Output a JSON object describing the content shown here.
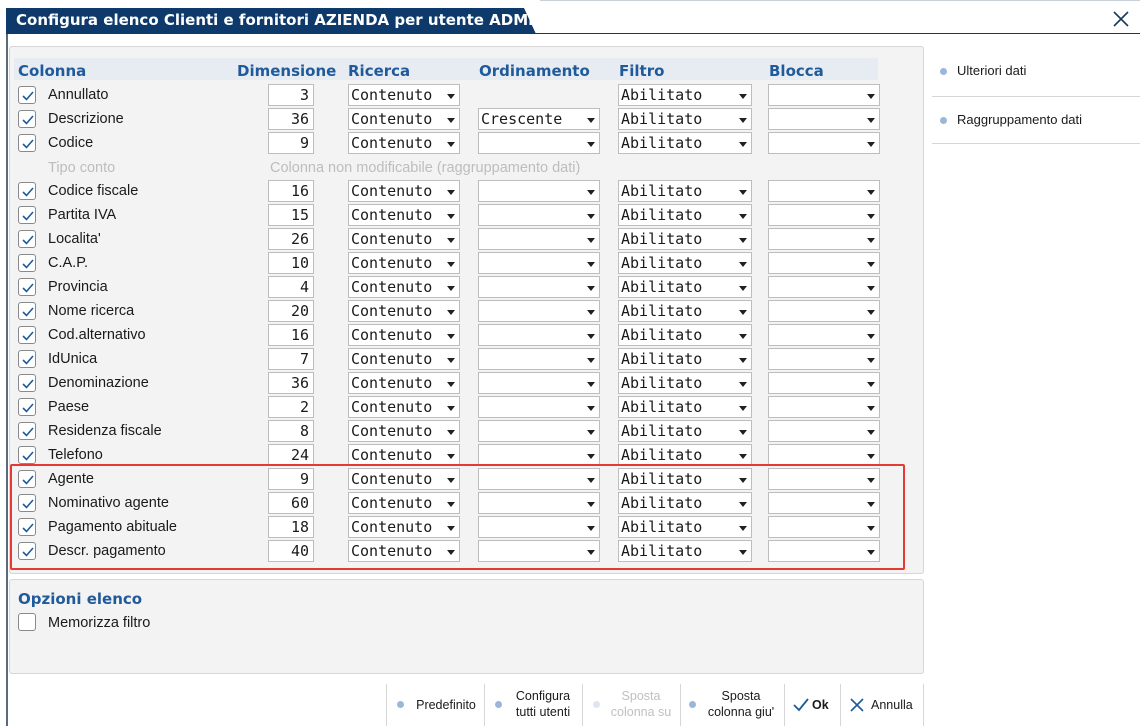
{
  "window": {
    "title": "Configura elenco Clienti e fornitori AZIENDA per utente ADMIN"
  },
  "headers": {
    "colonna": "Colonna",
    "dimensione": "Dimensione",
    "ricerca": "Ricerca",
    "ordinamento": "Ordinamento",
    "filtro": "Filtro",
    "blocca": "Blocca"
  },
  "rows": [
    {
      "name": "Annullato",
      "size": "3",
      "ricerca": "Contenuto",
      "ordinamento": null,
      "filtro": "Abilitato",
      "blocca": ""
    },
    {
      "name": "Descrizione",
      "size": "36",
      "ricerca": "Contenuto",
      "ordinamento": "Crescente",
      "filtro": "Abilitato",
      "blocca": ""
    },
    {
      "name": "Codice",
      "size": "9",
      "ricerca": "Contenuto",
      "ordinamento": "",
      "filtro": "Abilitato",
      "blocca": ""
    },
    {
      "name": "Codice fiscale",
      "size": "16",
      "ricerca": "Contenuto",
      "ordinamento": "",
      "filtro": "Abilitato",
      "blocca": ""
    },
    {
      "name": "Partita IVA",
      "size": "15",
      "ricerca": "Contenuto",
      "ordinamento": "",
      "filtro": "Abilitato",
      "blocca": ""
    },
    {
      "name": "Localita'",
      "size": "26",
      "ricerca": "Contenuto",
      "ordinamento": "",
      "filtro": "Abilitato",
      "blocca": ""
    },
    {
      "name": "C.A.P.",
      "size": "10",
      "ricerca": "Contenuto",
      "ordinamento": "",
      "filtro": "Abilitato",
      "blocca": ""
    },
    {
      "name": "Provincia",
      "size": "4",
      "ricerca": "Contenuto",
      "ordinamento": "",
      "filtro": "Abilitato",
      "blocca": ""
    },
    {
      "name": "Nome ricerca",
      "size": "20",
      "ricerca": "Contenuto",
      "ordinamento": "",
      "filtro": "Abilitato",
      "blocca": ""
    },
    {
      "name": "Cod.alternativo",
      "size": "16",
      "ricerca": "Contenuto",
      "ordinamento": "",
      "filtro": "Abilitato",
      "blocca": ""
    },
    {
      "name": "IdUnica",
      "size": "7",
      "ricerca": "Contenuto",
      "ordinamento": "",
      "filtro": "Abilitato",
      "blocca": ""
    },
    {
      "name": "Denominazione",
      "size": "36",
      "ricerca": "Contenuto",
      "ordinamento": "",
      "filtro": "Abilitato",
      "blocca": ""
    },
    {
      "name": "Paese",
      "size": "2",
      "ricerca": "Contenuto",
      "ordinamento": "",
      "filtro": "Abilitato",
      "blocca": ""
    },
    {
      "name": "Residenza fiscale",
      "size": "8",
      "ricerca": "Contenuto",
      "ordinamento": "",
      "filtro": "Abilitato",
      "blocca": ""
    },
    {
      "name": "Telefono",
      "size": "24",
      "ricerca": "Contenuto",
      "ordinamento": "",
      "filtro": "Abilitato",
      "blocca": ""
    },
    {
      "name": "Agente",
      "size": "9",
      "ricerca": "Contenuto",
      "ordinamento": "",
      "filtro": "Abilitato",
      "blocca": ""
    },
    {
      "name": "Nominativo agente",
      "size": "60",
      "ricerca": "Contenuto",
      "ordinamento": "",
      "filtro": "Abilitato",
      "blocca": ""
    },
    {
      "name": "Pagamento abituale",
      "size": "18",
      "ricerca": "Contenuto",
      "ordinamento": "",
      "filtro": "Abilitato",
      "blocca": ""
    },
    {
      "name": "Descr. pagamento",
      "size": "40",
      "ricerca": "Contenuto",
      "ordinamento": "",
      "filtro": "Abilitato",
      "blocca": ""
    }
  ],
  "info_row": {
    "name": "Tipo conto",
    "note": "Colonna non modificabile (raggruppamento dati)"
  },
  "options": {
    "title": "Opzioni elenco",
    "memorizza_filtro": "Memorizza filtro"
  },
  "side": {
    "ulteriori_dati": "Ulteriori dati",
    "raggruppamento_dati": "Raggruppamento dati"
  },
  "footer": {
    "predefinito": "Predefinito",
    "configura_1": "Configura",
    "configura_2": "tutti utenti",
    "sposta_su_1": "Sposta",
    "sposta_su_2": "colonna su",
    "sposta_giu_1": "Sposta",
    "sposta_giu_2": "colonna giu'",
    "ok": "Ok",
    "annulla": "Annulla"
  },
  "colors": {
    "title_bg": "#0e3a6b",
    "header_text": "#1f5a9a",
    "highlight_border": "#e53935"
  }
}
